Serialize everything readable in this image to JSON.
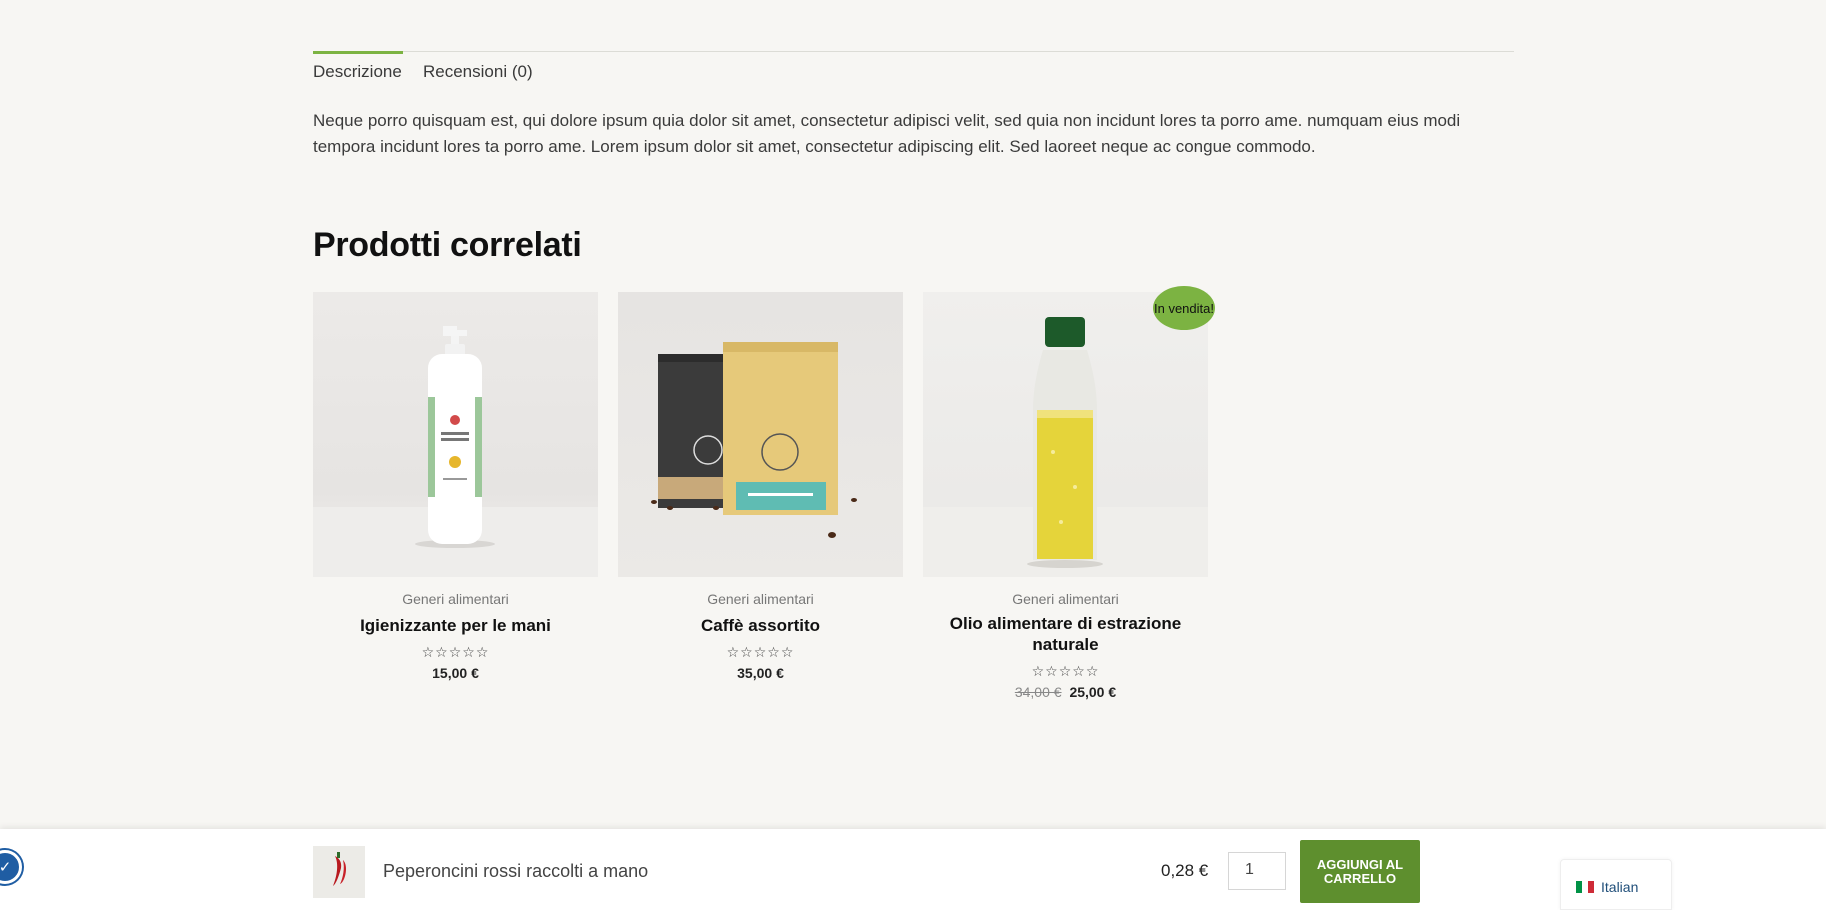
{
  "tabs": [
    {
      "label": "Descrizione",
      "active": true
    },
    {
      "label": "Recensioni (0)",
      "active": false
    }
  ],
  "description": "Neque porro quisquam est, qui dolore ipsum quia dolor sit amet, consectetur adipisci velit, sed quia non incidunt lores ta porro ame. numquam eius modi tempora incidunt lores ta porro ame. Lorem ipsum dolor sit amet, consectetur adipiscing elit. Sed laoreet neque ac congue commodo.",
  "related": {
    "title": "Prodotti correlati",
    "products": [
      {
        "category": "Generi alimentari",
        "name": "Igienizzante per le mani",
        "stars": "☆☆☆☆☆",
        "price": "15,00 €",
        "old_price": ""
      },
      {
        "category": "Generi alimentari",
        "name": "Caffè assortito",
        "stars": "☆☆☆☆☆",
        "price": "35,00 €",
        "old_price": ""
      },
      {
        "category": "Generi alimentari",
        "name": "Olio alimentare di estrazione naturale",
        "stars": "☆☆☆☆☆",
        "price": "25,00 €",
        "old_price": "34,00 €",
        "badge": "In vendita!"
      }
    ]
  },
  "sticky_bar": {
    "product_name": "Peperoncini rossi raccolti a mano",
    "price": "0,28 €",
    "quantity": "1",
    "add_to_cart": "AGGIUNGI AL CARRELLO"
  },
  "language": {
    "label": "Italian"
  },
  "colors": {
    "accent": "#7cb342",
    "button": "#5e8f2e",
    "background": "#f7f6f3"
  }
}
